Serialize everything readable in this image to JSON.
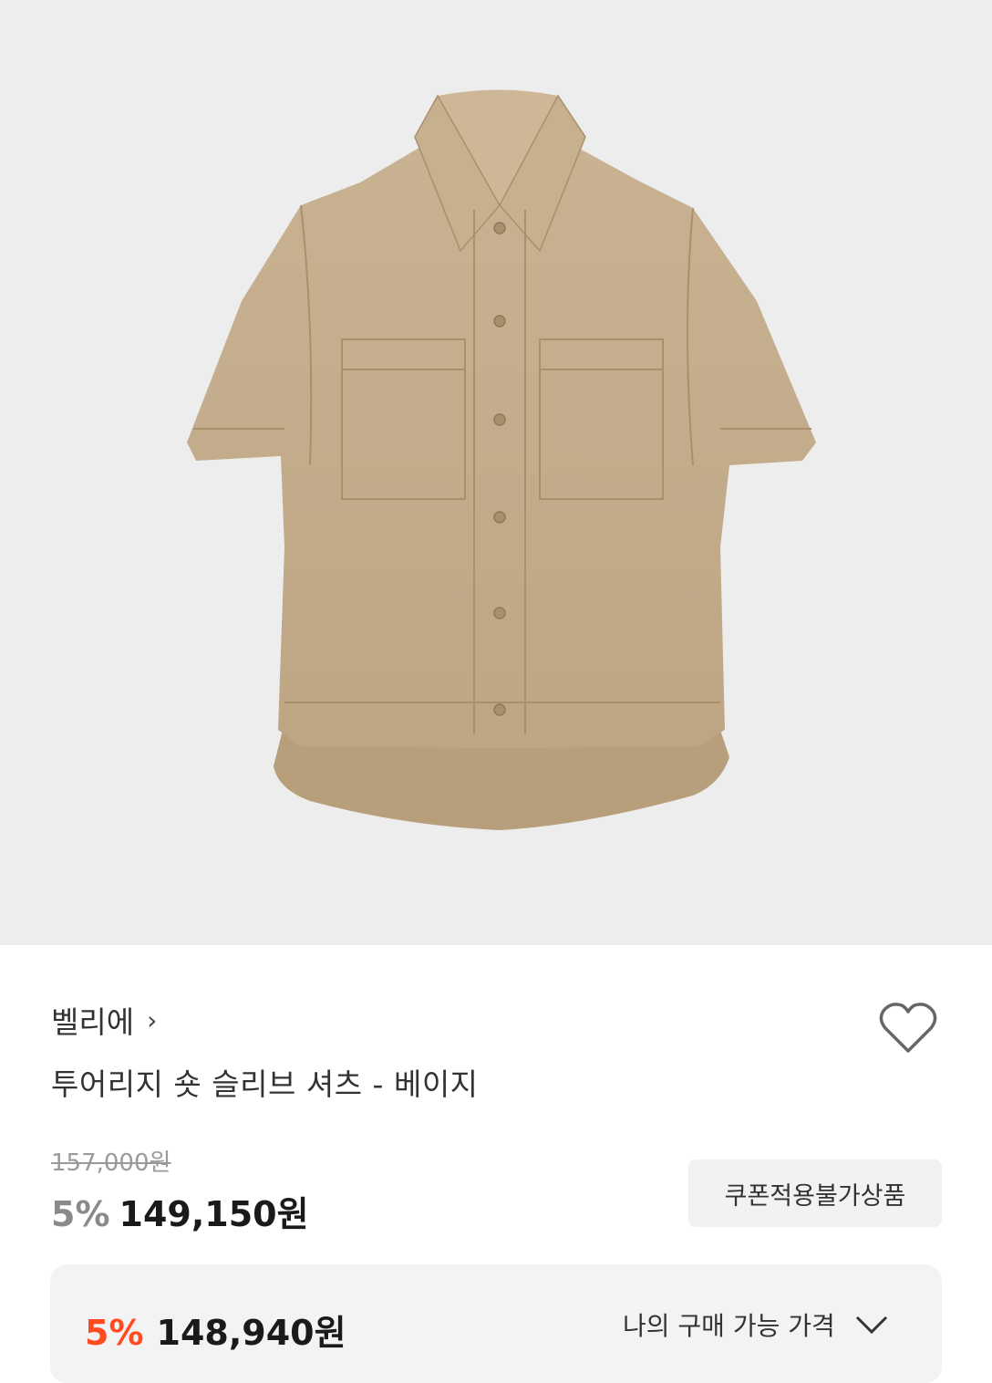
{
  "product": {
    "brand": "벨리에",
    "brand_chevron": "›",
    "title": "투어리지 숏 슬리브 셔츠 - 베이지",
    "wishlist_icon": "heart-outline-icon",
    "image_alt": "beige short sleeve shirt"
  },
  "pricing": {
    "original_price": "157,000원",
    "discount_percent": "5%",
    "sale_price": "149,150원",
    "coupon_notice": "쿠폰적용불가상품"
  },
  "my_price": {
    "discount_percent": "5%",
    "price": "148,940원",
    "label": "나의 구매 가능 가격",
    "expand_icon": "chevron-down-icon"
  },
  "colors": {
    "hero_bg": "#ededee",
    "shirt": "#c2ab8a",
    "accent_discount": "#ff4b1f",
    "muted_discount": "#8a8a8a"
  }
}
